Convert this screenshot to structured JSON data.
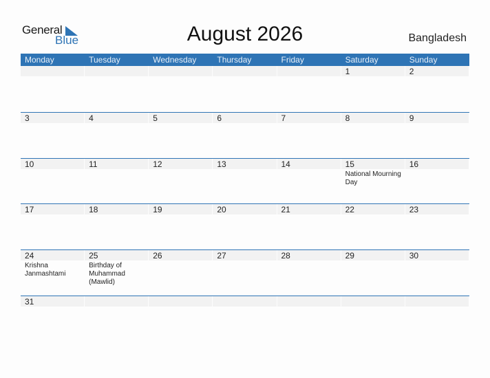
{
  "logo": {
    "line1": "General",
    "line2": "Blue"
  },
  "header": {
    "title": "August 2026",
    "country": "Bangladesh"
  },
  "colors": {
    "accent": "#2e74b5",
    "strip": "#f2f2f2"
  },
  "weekdays": [
    "Monday",
    "Tuesday",
    "Wednesday",
    "Thursday",
    "Friday",
    "Saturday",
    "Sunday"
  ],
  "weeks": [
    [
      {
        "d": ""
      },
      {
        "d": ""
      },
      {
        "d": ""
      },
      {
        "d": ""
      },
      {
        "d": ""
      },
      {
        "d": "1"
      },
      {
        "d": "2"
      }
    ],
    [
      {
        "d": "3"
      },
      {
        "d": "4"
      },
      {
        "d": "5"
      },
      {
        "d": "6"
      },
      {
        "d": "7"
      },
      {
        "d": "8"
      },
      {
        "d": "9"
      }
    ],
    [
      {
        "d": "10"
      },
      {
        "d": "11"
      },
      {
        "d": "12"
      },
      {
        "d": "13"
      },
      {
        "d": "14"
      },
      {
        "d": "15",
        "h": "National Mourning Day"
      },
      {
        "d": "16"
      }
    ],
    [
      {
        "d": "17"
      },
      {
        "d": "18"
      },
      {
        "d": "19"
      },
      {
        "d": "20"
      },
      {
        "d": "21"
      },
      {
        "d": "22"
      },
      {
        "d": "23"
      }
    ],
    [
      {
        "d": "24",
        "h": "Krishna Janmashtami"
      },
      {
        "d": "25",
        "h": "Birthday of Muhammad (Mawlid)"
      },
      {
        "d": "26"
      },
      {
        "d": "27"
      },
      {
        "d": "28"
      },
      {
        "d": "29"
      },
      {
        "d": "30"
      }
    ],
    [
      {
        "d": "31"
      },
      {
        "d": ""
      },
      {
        "d": ""
      },
      {
        "d": ""
      },
      {
        "d": ""
      },
      {
        "d": ""
      },
      {
        "d": ""
      }
    ]
  ]
}
